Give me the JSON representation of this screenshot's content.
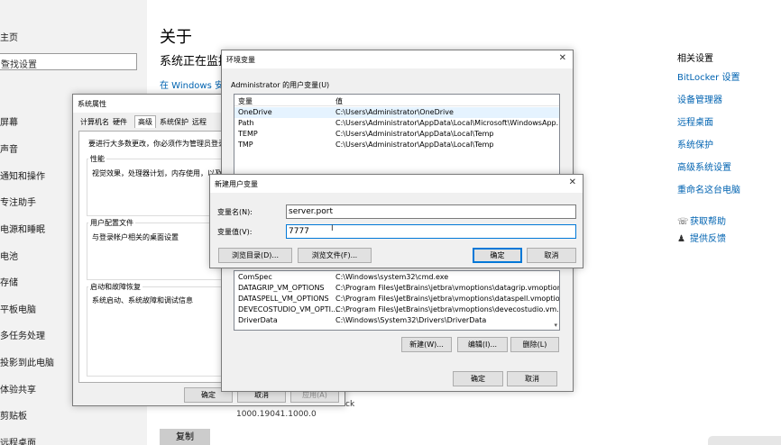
{
  "settings": {
    "left_items": [
      "主页",
      "屏幕",
      "声音",
      "通知和操作",
      "专注助手",
      "电源和睡眠",
      "电池",
      "存储",
      "平板电脑",
      "多任务处理",
      "投影到此电脑",
      "体验共享",
      "剪贴板",
      "远程桌面"
    ],
    "search_placeholder": "查找设置",
    "title": "关于",
    "subtitle": "系统正在监控",
    "security_link": "在 Windows 安全",
    "related_header": "相关设置",
    "related_links": [
      "BitLocker 设置",
      "设备管理器",
      "远程桌面",
      "系统保护",
      "高级系统设置",
      "重命名这台电脑"
    ],
    "help_link": "获取帮助",
    "feedback_link": "提供反馈",
    "version": "1000.19041.1000.0",
    "partial": "ck",
    "copy_button": "复制"
  },
  "sysprops": {
    "title": "系统属性",
    "tabs": [
      "计算机名",
      "硬件",
      "高级",
      "系统保护",
      "远程"
    ],
    "admin_note": "要进行大多数更改，你必须作为管理员登录。",
    "perf_label": "性能",
    "perf_text": "视觉效果，处理器计划，内存使用，以及虚",
    "profile_label": "用户配置文件",
    "profile_text": "与登录帐户相关的桌面设置",
    "startup_label": "启动和故障恢复",
    "startup_text": "系统启动、系统故障和调试信息",
    "ok": "确定",
    "cancel": "取消",
    "apply": "应用(A)"
  },
  "envvars": {
    "title": "环境变量",
    "user_section": "Administrator 的用户变量(U)",
    "col_var": "变量",
    "col_val": "值",
    "user_vars": [
      {
        "name": "OneDrive",
        "value": "C:\\Users\\Administrator\\OneDrive"
      },
      {
        "name": "Path",
        "value": "C:\\Users\\Administrator\\AppData\\Local\\Microsoft\\WindowsApp..."
      },
      {
        "name": "TEMP",
        "value": "C:\\Users\\Administrator\\AppData\\Local\\Temp"
      },
      {
        "name": "TMP",
        "value": "C:\\Users\\Administrator\\AppData\\Local\\Temp"
      }
    ],
    "sys_vars": [
      {
        "name": "ComSpec",
        "value": "C:\\Windows\\system32\\cmd.exe"
      },
      {
        "name": "DATAGRIP_VM_OPTIONS",
        "value": "C:\\Program Files\\JetBrains\\jetbra\\vmoptions\\datagrip.vmoptions"
      },
      {
        "name": "DATASPELL_VM_OPTIONS",
        "value": "C:\\Program Files\\JetBrains\\jetbra\\vmoptions\\dataspell.vmoptio..."
      },
      {
        "name": "DEVECOSTUDIO_VM_OPTI...",
        "value": "C:\\Program Files\\JetBrains\\jetbra\\vmoptions\\devecostudio.vm..."
      },
      {
        "name": "DriverData",
        "value": "C:\\Windows\\System32\\Drivers\\DriverData"
      }
    ],
    "new_btn": "新建(W)...",
    "edit_btn": "编辑(I)...",
    "delete_btn": "删除(L)",
    "ok": "确定",
    "cancel": "取消"
  },
  "newvar": {
    "title": "新建用户变量",
    "name_label": "变量名(N):",
    "name_value": "server.port",
    "value_label": "变量值(V):",
    "value_value": "7777",
    "browse_dir": "浏览目录(D)...",
    "browse_file": "浏览文件(F)...",
    "ok": "确定",
    "cancel": "取消"
  }
}
